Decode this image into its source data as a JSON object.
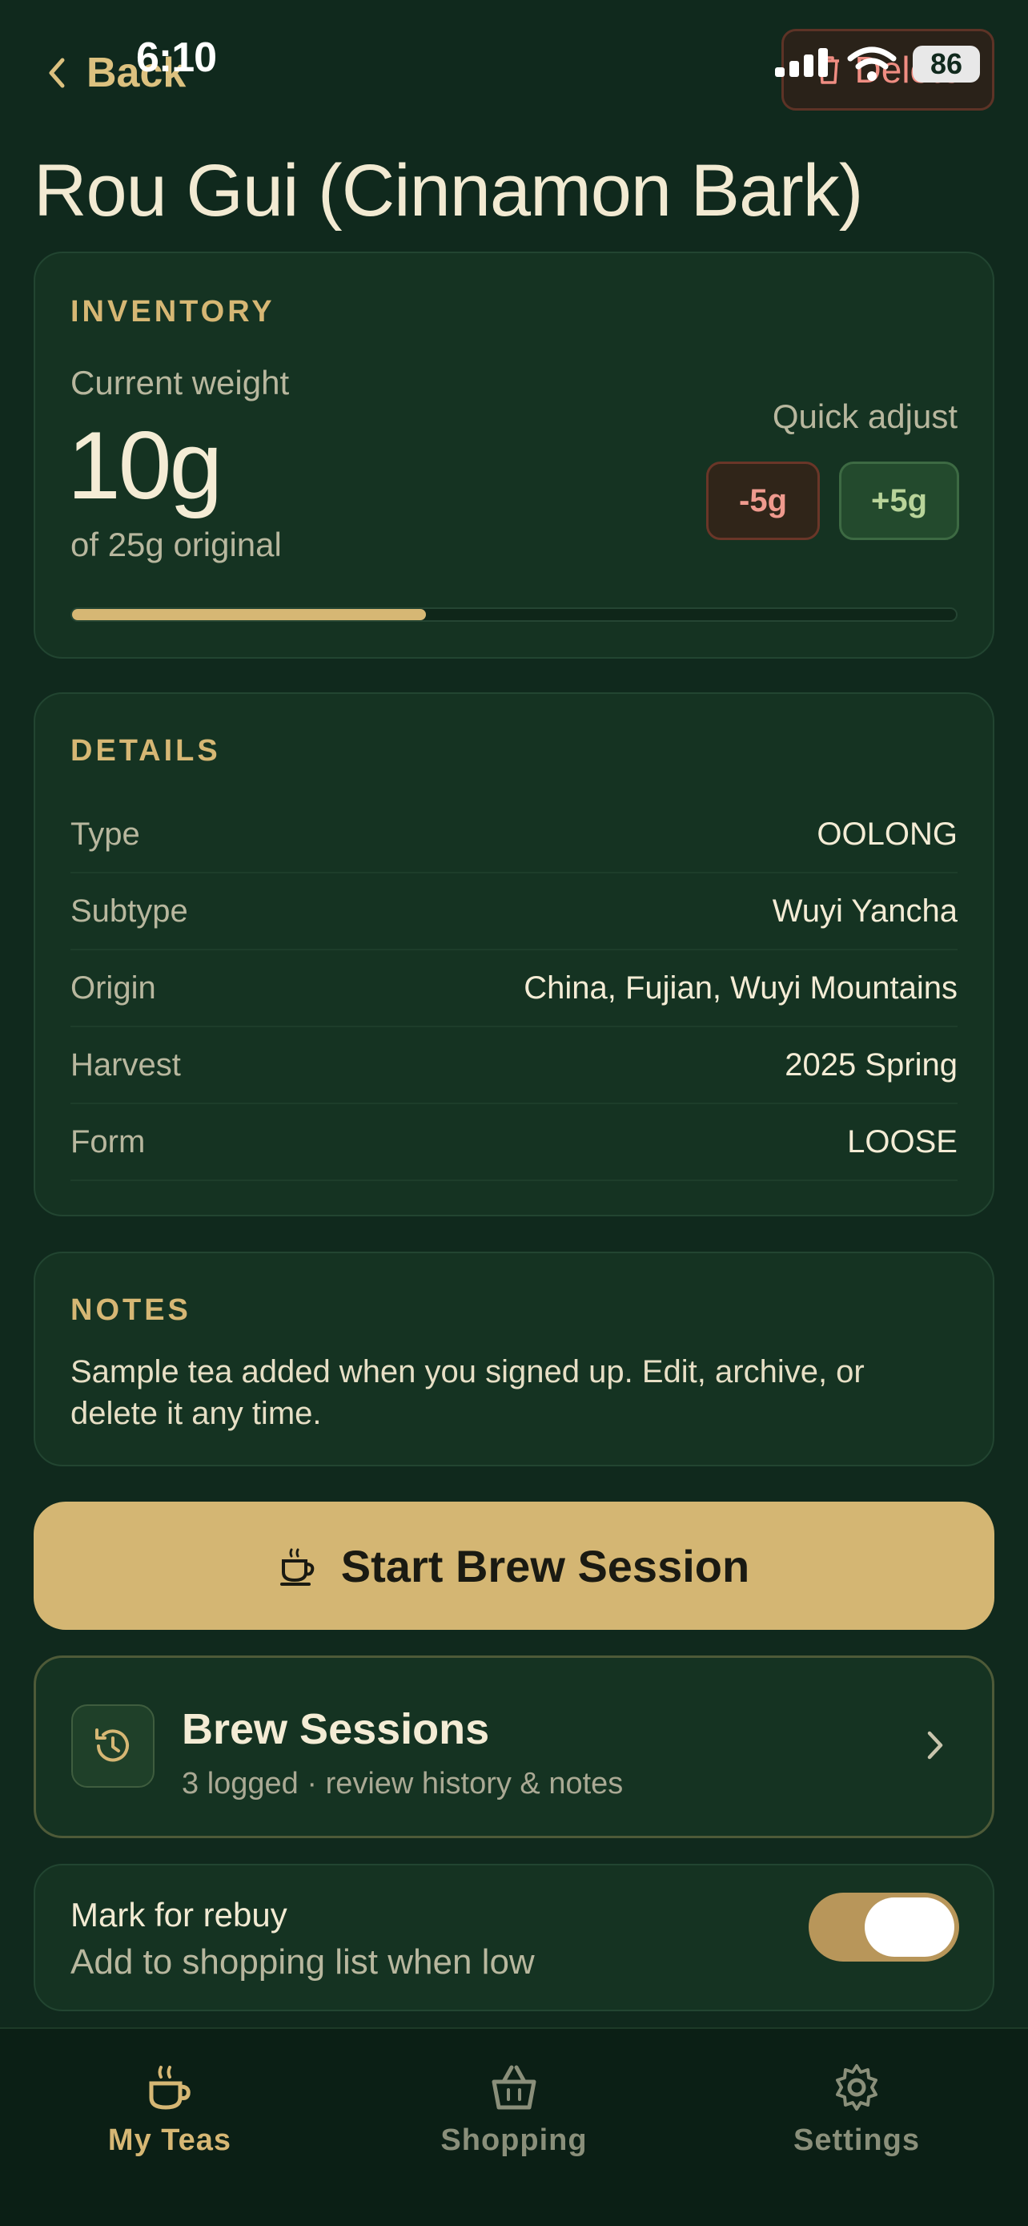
{
  "status_bar": {
    "time": "6:10",
    "battery": "86"
  },
  "header": {
    "back_label": "Back",
    "delete_label": "Delete"
  },
  "title": "Rou Gui (Cinnamon Bark)",
  "inventory": {
    "section_label": "INVENTORY",
    "current_weight_label": "Current weight",
    "current_weight": "10g",
    "original_text": "of 25g original",
    "quick_adjust_label": "Quick adjust",
    "minus_label": "-5g",
    "plus_label": "+5g",
    "remaining_fraction": 0.4
  },
  "details": {
    "section_label": "DETAILS",
    "rows": [
      {
        "key": "Type",
        "value": "OOLONG"
      },
      {
        "key": "Subtype",
        "value": "Wuyi Yancha"
      },
      {
        "key": "Origin",
        "value": "China, Fujian, Wuyi Mountains"
      },
      {
        "key": "Harvest",
        "value": "2025 Spring"
      },
      {
        "key": "Form",
        "value": "LOOSE"
      }
    ]
  },
  "notes": {
    "section_label": "NOTES",
    "text": "Sample tea added when you signed up. Edit, archive, or delete it any time."
  },
  "brew_button": {
    "label": "Start Brew Session",
    "icon": "teacup-icon"
  },
  "sessions": {
    "title": "Brew Sessions",
    "subtitle": "3 logged · review history & notes",
    "icon": "history-icon"
  },
  "rebuy": {
    "title": "Mark for rebuy",
    "subtitle": "Add to shopping list when low",
    "enabled": true
  },
  "nav": {
    "items": [
      {
        "label": "My Teas",
        "icon": "teacup-icon",
        "active": true
      },
      {
        "label": "Shopping",
        "icon": "basket-icon",
        "active": false
      },
      {
        "label": "Settings",
        "icon": "gear-icon",
        "active": false
      }
    ]
  },
  "colors": {
    "background": "#10291d",
    "card": "#153322",
    "accent": "#d6b774",
    "danger": "#ef8d82"
  }
}
